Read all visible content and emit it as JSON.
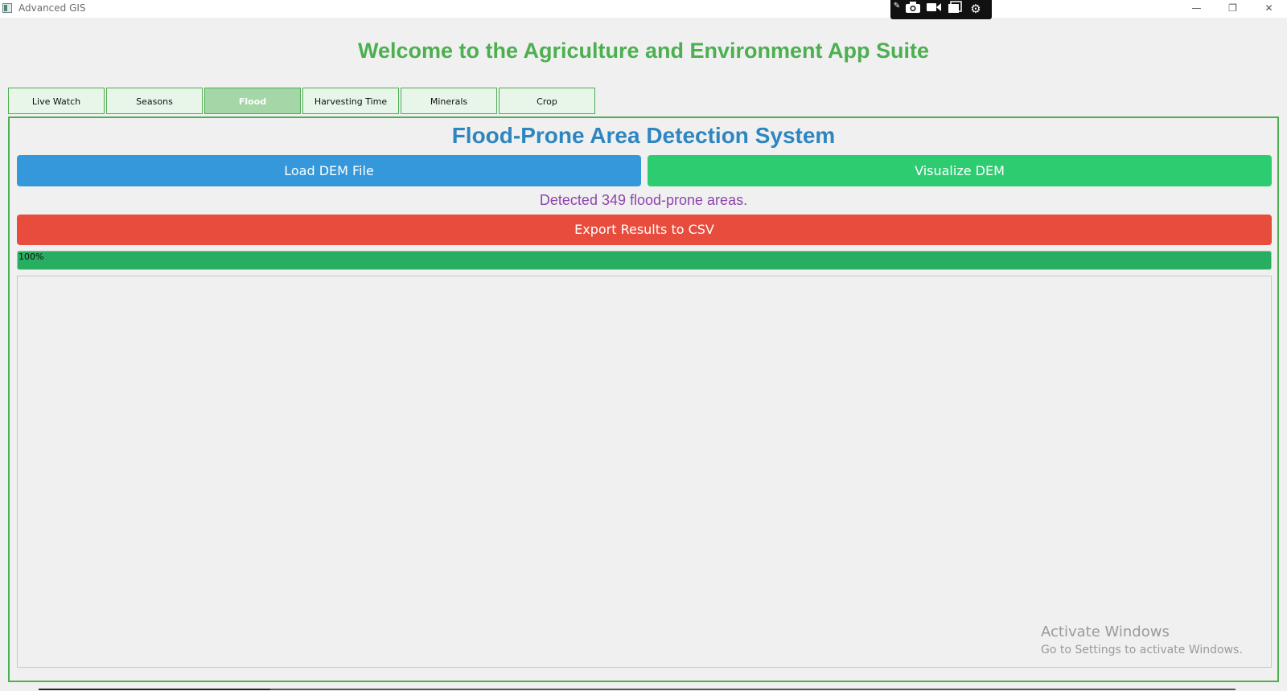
{
  "window": {
    "title": "Advanced GIS",
    "controls": {
      "minimize": "—",
      "restore": "❐",
      "close": "✕"
    }
  },
  "capture_toolbar": {
    "icons": [
      "pin-icon",
      "camera-icon",
      "video-icon",
      "window-icon",
      "gear-icon"
    ]
  },
  "suite_heading": "Welcome to the Agriculture and Environment App Suite",
  "tabs": [
    {
      "label": "Live Watch",
      "active": false
    },
    {
      "label": "Seasons",
      "active": false
    },
    {
      "label": "Flood",
      "active": true
    },
    {
      "label": "Harvesting Time",
      "active": false
    },
    {
      "label": "Minerals",
      "active": false
    },
    {
      "label": "Crop",
      "active": false
    }
  ],
  "flood": {
    "title": "Flood-Prone Area Detection System",
    "load_button": "Load DEM File",
    "visualize_button": "Visualize DEM",
    "status": "Detected 349 flood-prone areas.",
    "export_button": "Export Results to CSV",
    "progress": {
      "value": 1.0,
      "label": "100%"
    }
  },
  "watermark": {
    "line1": "Activate Windows",
    "line2": "Go to Settings to activate Windows."
  },
  "colors": {
    "heading_green": "#4caf50",
    "title_blue": "#2e86c1",
    "load_blue": "#3498db",
    "visualize_green": "#2ecc71",
    "export_red": "#e74c3c",
    "status_purple": "#8e44ad",
    "progress_green": "#27ae60"
  }
}
